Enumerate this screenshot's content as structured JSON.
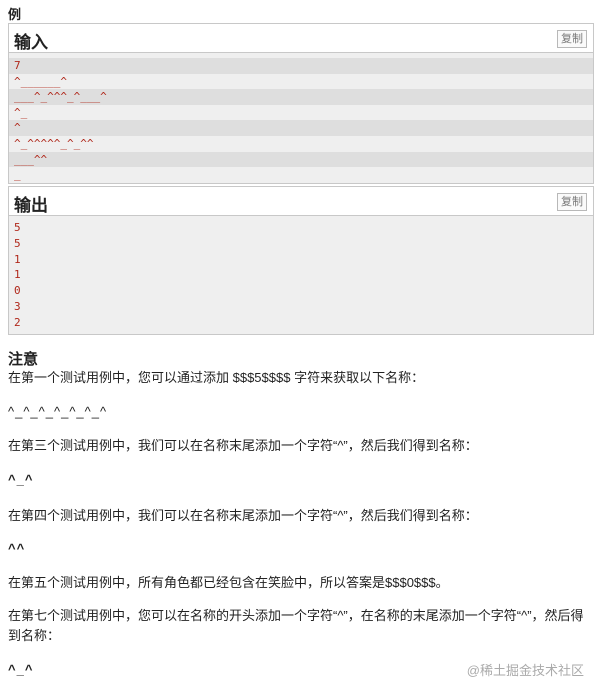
{
  "example_title": "例",
  "input": {
    "title": "输入",
    "copy_label": "复制",
    "lines": [
      "7",
      "^______^",
      "___^_^^^_^___^",
      "^_",
      "^",
      "^_^^^^^_^_^^",
      "___^^",
      "_"
    ]
  },
  "output": {
    "title": "输出",
    "copy_label": "复制",
    "lines": [
      "5",
      "5",
      "1",
      "1",
      "0",
      "3",
      "2"
    ]
  },
  "note": {
    "title": "注意",
    "p1": "在第一个测试用例中，您可以通过添加 $$$5$$$$ 字符来获取以下名称：",
    "face1": "^_^_^_^_^_^_^",
    "p2": "在第三个测试用例中，我们可以在名称末尾添加一个字符“^”，然后我们得到名称：",
    "face2": "^_^",
    "p3": "在第四个测试用例中，我们可以在名称末尾添加一个字符“^”，然后我们得到名称：",
    "face3": "^^",
    "p4": "在第五个测试用例中，所有角色都已经包含在笑脸中，所以答案是$$$0$$$。",
    "p5": "在第七个测试用例中，您可以在名称的开头添加一个字符“^”，在名称的末尾添加一个字符“^”，然后得到名称：",
    "face4": "^_^"
  },
  "watermark": "@稀土掘金技术社区"
}
